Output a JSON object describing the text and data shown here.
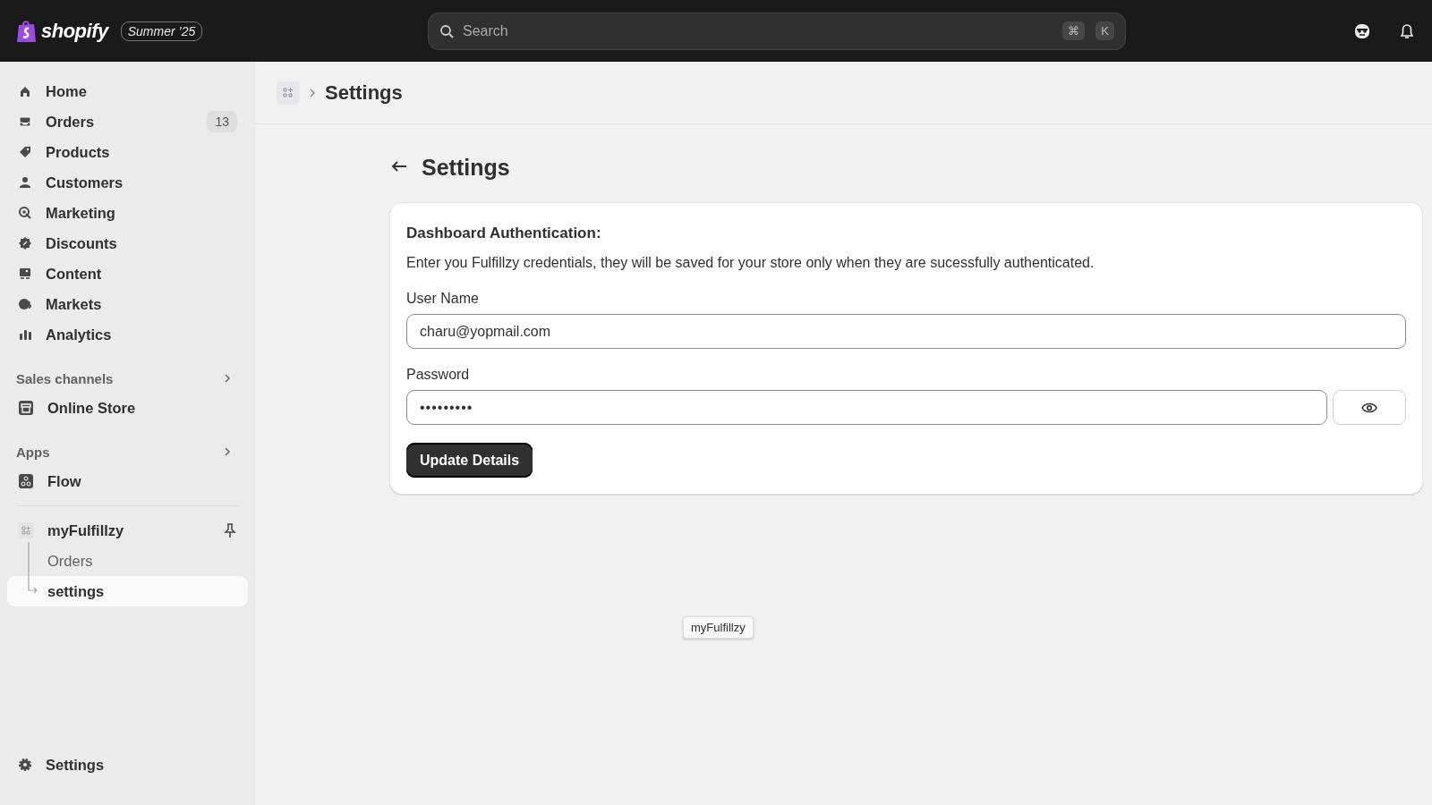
{
  "topbar": {
    "logo": "shopify",
    "edition": "Summer ’25",
    "search": {
      "placeholder": "Search"
    },
    "shortcut": [
      "⌘",
      "K"
    ]
  },
  "sidebar": {
    "items": [
      {
        "label": "Home",
        "selected": false
      },
      {
        "label": "Orders",
        "badge": "13",
        "selected": false
      },
      {
        "label": "Products",
        "selected": false
      },
      {
        "label": "Customers",
        "selected": false
      },
      {
        "label": "Marketing",
        "selected": false
      },
      {
        "label": "Discounts",
        "selected": false
      },
      {
        "label": "Content",
        "selected": false
      },
      {
        "label": "Markets",
        "selected": false
      },
      {
        "label": "Analytics",
        "selected": false
      }
    ],
    "sales_channels": {
      "title": "Sales channels",
      "items": [
        {
          "label": "Online Store",
          "selected": false
        }
      ]
    },
    "apps": {
      "title": "Apps",
      "items": [
        {
          "label": "Flow",
          "selected": false
        }
      ]
    },
    "pinned_app": {
      "label": "myFulfillzy",
      "children": [
        {
          "label": "Orders",
          "selected": false
        },
        {
          "label": "settings",
          "selected": true
        }
      ]
    },
    "footer": {
      "label": "Settings"
    }
  },
  "breadcrumb": {
    "title": "Settings"
  },
  "page": {
    "title": "Settings",
    "card": {
      "heading": "Dashboard Authentication:",
      "description": "Enter you Fulfillzy credentials, they will be saved for your store only when they are sucessfully authenticated.",
      "fields": [
        {
          "label": "User Name",
          "value": "charu@yopmail.com",
          "kind": "text"
        },
        {
          "label": "Password",
          "value": "•••••••••",
          "kind": "password"
        }
      ],
      "button": "Update Details"
    }
  },
  "tooltip": "myFulfillzy"
}
